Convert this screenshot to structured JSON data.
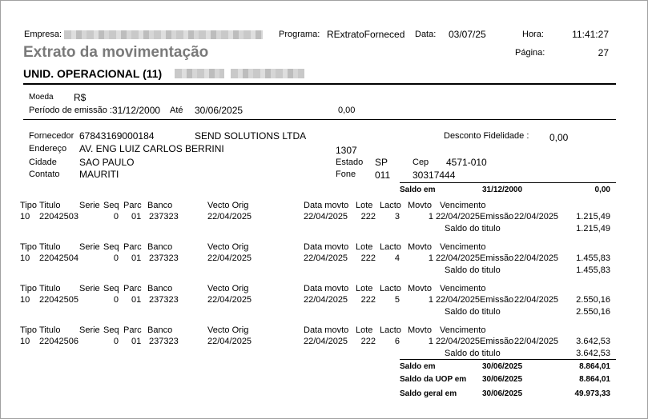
{
  "header": {
    "empresa_label": "Empresa:",
    "programa_label": "Programa:",
    "programa_value": "RExtratoForneced",
    "data_label": "Data:",
    "data_value": "03/07/25",
    "hora_label": "Hora:",
    "hora_value": "11:41:27",
    "pagina_label": "Página:",
    "pagina_value": "27",
    "title": "Extrato da movimentação",
    "unit_label": "UNID. OPERACIONAL (11)"
  },
  "period": {
    "moeda_label": "Moeda",
    "moeda_value": "R$",
    "periodo_label": "Período de emissão :",
    "periodo_start": "31/12/2000",
    "ate_label": "Até",
    "periodo_end": "30/06/2025",
    "value": "0,00"
  },
  "supplier": {
    "fornecedor_label": "Fornecedor",
    "fornecedor_code": "67843169000184",
    "fornecedor_name": "SEND SOLUTIONS LTDA",
    "desconto_label": "Desconto Fidelidade :",
    "desconto_value": "0,00",
    "endereco_label": "Endereço",
    "endereco_value": "AV. ENG LUIZ CARLOS BERRINI",
    "numero": "1307",
    "cidade_label": "Cidade",
    "cidade_value": "SAO PAULO",
    "estado_label": "Estado",
    "estado_value": "SP",
    "cep_label": "Cep",
    "cep_value": "4571-010",
    "contato_label": "Contato",
    "contato_value": "MAURITI",
    "fone_label": "Fone",
    "fone_ddd": "011",
    "fone_number": "30317444"
  },
  "saldo_inicial": {
    "label": "Saldo em",
    "date": "31/12/2000",
    "value": "0,00"
  },
  "columns": [
    "Tipo",
    "Titulo",
    "Serie",
    "Seq",
    "Parc",
    "Banco",
    "Vecto Orig",
    "Data movto",
    "Lote",
    "Lacto",
    "Movto",
    "Vencimento"
  ],
  "emissao_label": "Emissão",
  "saldo_titulo_label": "Saldo do titulo",
  "entries": [
    {
      "tipo": "10",
      "titulo": "22042503",
      "seq": "0",
      "parc": "01",
      "banco": "237323",
      "vecto": "22/04/2025",
      "data_movto": "22/04/2025",
      "lote": "222",
      "lacto": "3",
      "movto": "1",
      "vencimento": "22/04/2025",
      "emissao": "22/04/2025",
      "valor": "1.215,49",
      "saldo": "1.215,49"
    },
    {
      "tipo": "10",
      "titulo": "22042504",
      "seq": "0",
      "parc": "01",
      "banco": "237323",
      "vecto": "22/04/2025",
      "data_movto": "22/04/2025",
      "lote": "222",
      "lacto": "4",
      "movto": "1",
      "vencimento": "22/04/2025",
      "emissao": "22/04/2025",
      "valor": "1.455,83",
      "saldo": "1.455,83"
    },
    {
      "tipo": "10",
      "titulo": "22042505",
      "seq": "0",
      "parc": "01",
      "banco": "237323",
      "vecto": "22/04/2025",
      "data_movto": "22/04/2025",
      "lote": "222",
      "lacto": "5",
      "movto": "1",
      "vencimento": "22/04/2025",
      "emissao": "22/04/2025",
      "valor": "2.550,16",
      "saldo": "2.550,16"
    },
    {
      "tipo": "10",
      "titulo": "22042506",
      "seq": "0",
      "parc": "01",
      "banco": "237323",
      "vecto": "22/04/2025",
      "data_movto": "22/04/2025",
      "lote": "222",
      "lacto": "6",
      "movto": "1",
      "vencimento": "22/04/2025",
      "emissao": "22/04/2025",
      "valor": "3.642,53",
      "saldo": "3.642,53"
    }
  ],
  "totals": [
    {
      "label": "Saldo em",
      "date": "30/06/2025",
      "value": "8.864,01"
    },
    {
      "label": "Saldo da UOP em",
      "date": "30/06/2025",
      "value": "8.864,01"
    },
    {
      "label": "Saldo geral em",
      "date": "30/06/2025",
      "value": "49.973,33"
    }
  ]
}
